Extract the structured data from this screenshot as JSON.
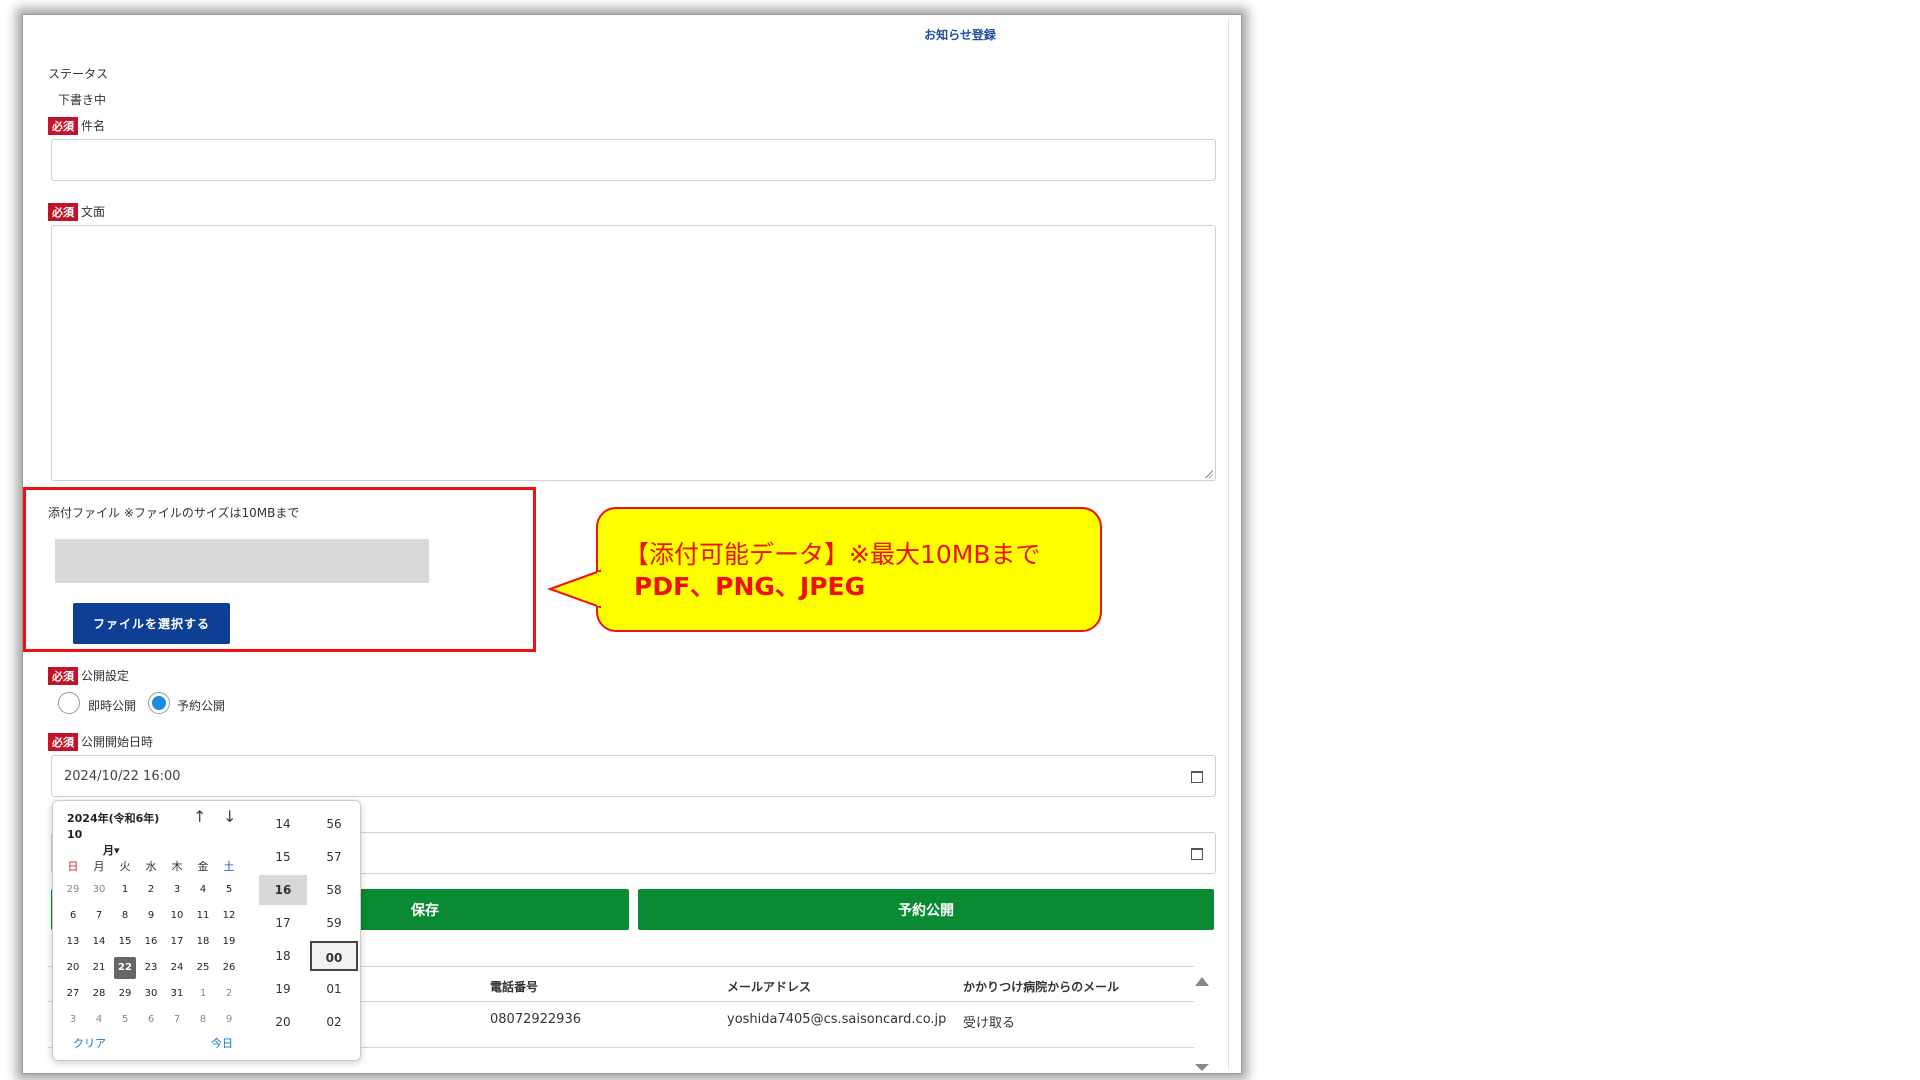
{
  "form": {
    "title": "お知らせ登録",
    "status_label": "ステータス",
    "status_value": "下書き中",
    "required_badge": "必須",
    "subject_label": "件名",
    "body_label": "文面",
    "attachment_label": "添付ファイル ※ファイルのサイズは10MBまで",
    "file_button": "ファイルを選択する",
    "publish_setting_label": "公開設定",
    "radio_immediate": "即時公開",
    "radio_scheduled": "予約公開",
    "publish_start_label": "公開開始日時",
    "publish_start_value": "2024/10/22 16:00",
    "save_button": "保存",
    "publish_button": "予約公開"
  },
  "callout": {
    "line1": "【添付可能データ】※最大10MBまで",
    "line2": "PDF、PNG、JPEG"
  },
  "table": {
    "headers": [
      "電話番号",
      "メールアドレス",
      "かかりつけ病院からのメール"
    ],
    "row": {
      "phone": "08072922936",
      "email": "yoshida7405@cs.saisoncard.co.jp",
      "mail_pref": "受け取る"
    }
  },
  "datepicker": {
    "title_line1": "2024年(令和6年) 10",
    "title_line2": "月▾",
    "weekdays": [
      "日",
      "月",
      "火",
      "水",
      "木",
      "金",
      "土"
    ],
    "weeks": [
      [
        "29",
        "30",
        "1",
        "2",
        "3",
        "4",
        "5"
      ],
      [
        "6",
        "7",
        "8",
        "9",
        "10",
        "11",
        "12"
      ],
      [
        "13",
        "14",
        "15",
        "16",
        "17",
        "18",
        "19"
      ],
      [
        "20",
        "21",
        "22",
        "23",
        "24",
        "25",
        "26"
      ],
      [
        "27",
        "28",
        "29",
        "30",
        "31",
        "1",
        "2"
      ],
      [
        "3",
        "4",
        "5",
        "6",
        "7",
        "8",
        "9"
      ]
    ],
    "selected_day": "22",
    "clear": "クリア",
    "today": "今日",
    "hours": [
      "14",
      "15",
      "16",
      "17",
      "18",
      "19",
      "20"
    ],
    "selected_hour": "16",
    "minutes": [
      "56",
      "57",
      "58",
      "59",
      "00",
      "01",
      "02"
    ],
    "selected_minute": "00"
  },
  "colors": {
    "required": "#c2132a",
    "primary": "#0f3f94",
    "green": "#0a8a32",
    "highlight": "#e11111",
    "callout": "#ffff00"
  }
}
